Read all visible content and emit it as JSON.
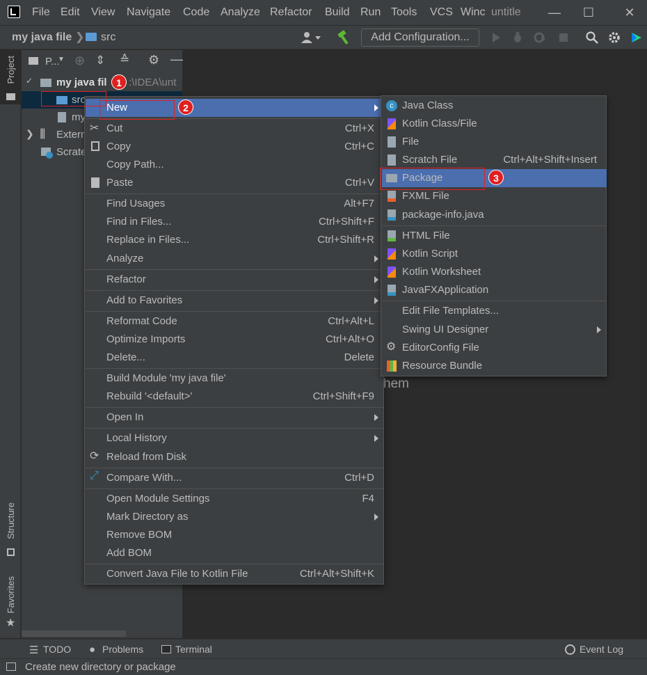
{
  "menubar": {
    "items": [
      "File",
      "Edit",
      "View",
      "Navigate",
      "Code",
      "Analyze",
      "Refactor",
      "Build",
      "Run",
      "Tools",
      "VCS",
      "Winc"
    ],
    "window_title": "untitle"
  },
  "navbar": {
    "project": "my java file",
    "folder": "src",
    "add_configuration": "Add Configuration..."
  },
  "left_strip": {
    "project_tab": "Project",
    "structure_tab": "Structure",
    "favorites_tab": "Favorites"
  },
  "project_panel": {
    "header_label": "P...",
    "tree": {
      "root_label": "my java fil",
      "root_path": ":\\IDEA\\unt",
      "src_label": "src",
      "iml_label": "my",
      "external_label": "Extern",
      "scratches_label": "Scrate"
    }
  },
  "editor": {
    "hint_text": "hem"
  },
  "context_menu": {
    "new": "New",
    "cut": "Cut",
    "cut_sc": "Ctrl+X",
    "copy": "Copy",
    "copy_sc": "Ctrl+C",
    "copy_path": "Copy Path...",
    "paste": "Paste",
    "paste_sc": "Ctrl+V",
    "find_usages": "Find Usages",
    "find_usages_sc": "Alt+F7",
    "find_in_files": "Find in Files...",
    "find_in_files_sc": "Ctrl+Shift+F",
    "replace_in_files": "Replace in Files...",
    "replace_in_files_sc": "Ctrl+Shift+R",
    "analyze": "Analyze",
    "refactor": "Refactor",
    "add_to_favorites": "Add to Favorites",
    "reformat_code": "Reformat Code",
    "reformat_code_sc": "Ctrl+Alt+L",
    "optimize_imports": "Optimize Imports",
    "optimize_imports_sc": "Ctrl+Alt+O",
    "delete": "Delete...",
    "delete_sc": "Delete",
    "build_module": "Build Module 'my java file'",
    "rebuild": "Rebuild '<default>'",
    "rebuild_sc": "Ctrl+Shift+F9",
    "open_in": "Open In",
    "local_history": "Local History",
    "reload_from_disk": "Reload from Disk",
    "compare_with": "Compare With...",
    "compare_with_sc": "Ctrl+D",
    "open_module_settings": "Open Module Settings",
    "open_module_settings_sc": "F4",
    "mark_directory_as": "Mark Directory as",
    "remove_bom": "Remove BOM",
    "add_bom": "Add BOM",
    "convert_java_to_kotlin": "Convert Java File to Kotlin File",
    "convert_java_to_kotlin_sc": "Ctrl+Alt+Shift+K"
  },
  "sub_menu": {
    "java_class": "Java Class",
    "kotlin_class": "Kotlin Class/File",
    "file": "File",
    "scratch_file": "Scratch File",
    "scratch_file_sc": "Ctrl+Alt+Shift+Insert",
    "package": "Package",
    "fxml_file": "FXML File",
    "package_info": "package-info.java",
    "html_file": "HTML File",
    "kotlin_script": "Kotlin Script",
    "kotlin_worksheet": "Kotlin Worksheet",
    "javafx_application": "JavaFXApplication",
    "edit_file_templates": "Edit File Templates...",
    "swing_ui_designer": "Swing UI Designer",
    "editorconfig_file": "EditorConfig File",
    "resource_bundle": "Resource Bundle"
  },
  "annotations": {
    "one": "1",
    "two": "2",
    "three": "3"
  },
  "bottom_bar": {
    "todo": "TODO",
    "problems": "Problems",
    "terminal": "Terminal",
    "event_log": "Event Log"
  },
  "status_bar": {
    "text": "Create new directory or package"
  },
  "colors": {
    "selection": "#4b6eaf",
    "annotation": "#e02020",
    "panel": "#3c3f41",
    "editor": "#2b2b2b"
  },
  "icons": [
    "app-logo-icon",
    "folder-icon",
    "user-icon",
    "hammer-icon",
    "run-icon",
    "debug-icon",
    "coverage-icon",
    "stop-icon",
    "search-icon",
    "gear-icon",
    "jetbrains-icon",
    "scissors-icon",
    "copy-icon",
    "paste-icon",
    "reload-icon",
    "compare-icon"
  ]
}
